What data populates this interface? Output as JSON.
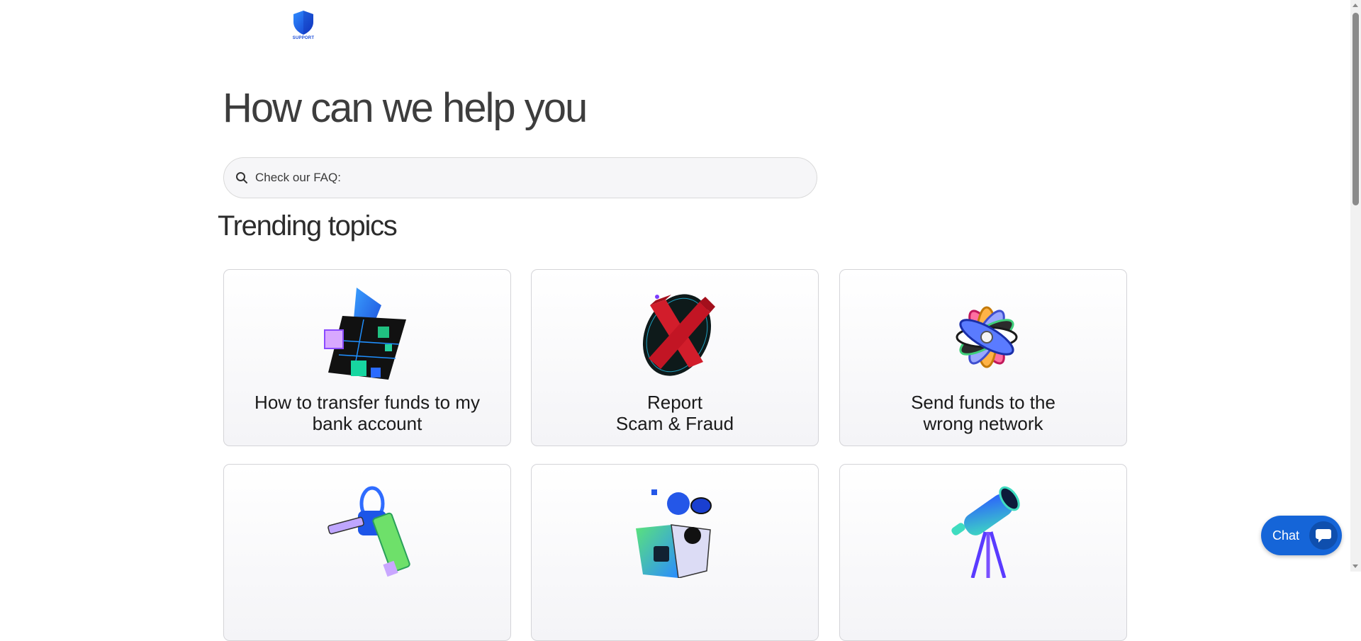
{
  "brand": {
    "logo_text": "SUPPORT",
    "accent": "#1565d8"
  },
  "hero": {
    "title": "How can we help you"
  },
  "search": {
    "placeholder": "Check our FAQ:",
    "value": ""
  },
  "trending": {
    "title": "Trending topics",
    "cards": [
      {
        "label": "How to transfer funds to my\nbank account",
        "icon": "card-transfer-icon"
      },
      {
        "label": "Report\nScam & Fraud",
        "icon": "red-x-icon"
      },
      {
        "label": "Send funds to the\nwrong network",
        "icon": "coins-fan-icon"
      },
      {
        "label": "",
        "icon": "keys-icon"
      },
      {
        "label": "",
        "icon": "wallet-icon"
      },
      {
        "label": "",
        "icon": "telescope-icon"
      }
    ]
  },
  "chat": {
    "label": "Chat",
    "icon": "chat-bubble-icon"
  }
}
